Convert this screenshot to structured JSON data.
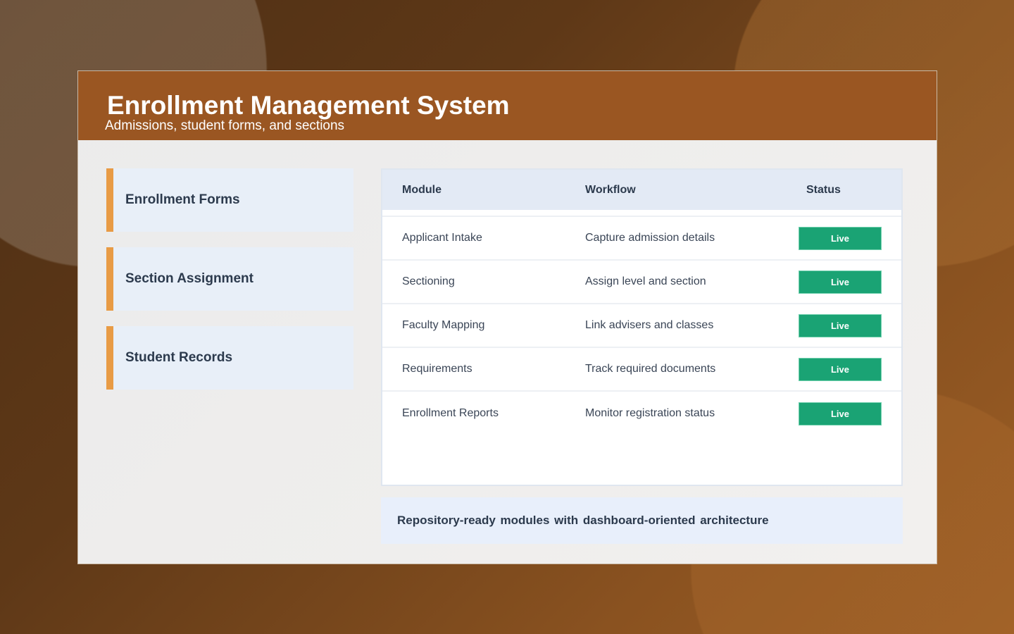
{
  "header": {
    "title": "Enrollment Management System",
    "subtitle": "Admissions, student forms, and sections"
  },
  "sidebar": {
    "items": [
      {
        "label": "Enrollment Forms"
      },
      {
        "label": "Section Assignment"
      },
      {
        "label": "Student Records"
      }
    ]
  },
  "table": {
    "headers": [
      "Module",
      "Workflow",
      "Status"
    ],
    "rows": [
      {
        "module": "Applicant Intake",
        "workflow": "Capture admission details",
        "status": "Live"
      },
      {
        "module": "Sectioning",
        "workflow": "Assign level and section",
        "status": "Live"
      },
      {
        "module": "Faculty Mapping",
        "workflow": "Link advisers and classes",
        "status": "Live"
      },
      {
        "module": "Requirements",
        "workflow": "Track required documents",
        "status": "Live"
      },
      {
        "module": "Enrollment Reports",
        "workflow": "Monitor registration status",
        "status": "Live"
      }
    ]
  },
  "footer_note": "Repository-ready modules with dashboard-oriented architecture",
  "colors": {
    "header": "#9a5622",
    "accent": "#e89b45",
    "live": "#1aa374"
  }
}
